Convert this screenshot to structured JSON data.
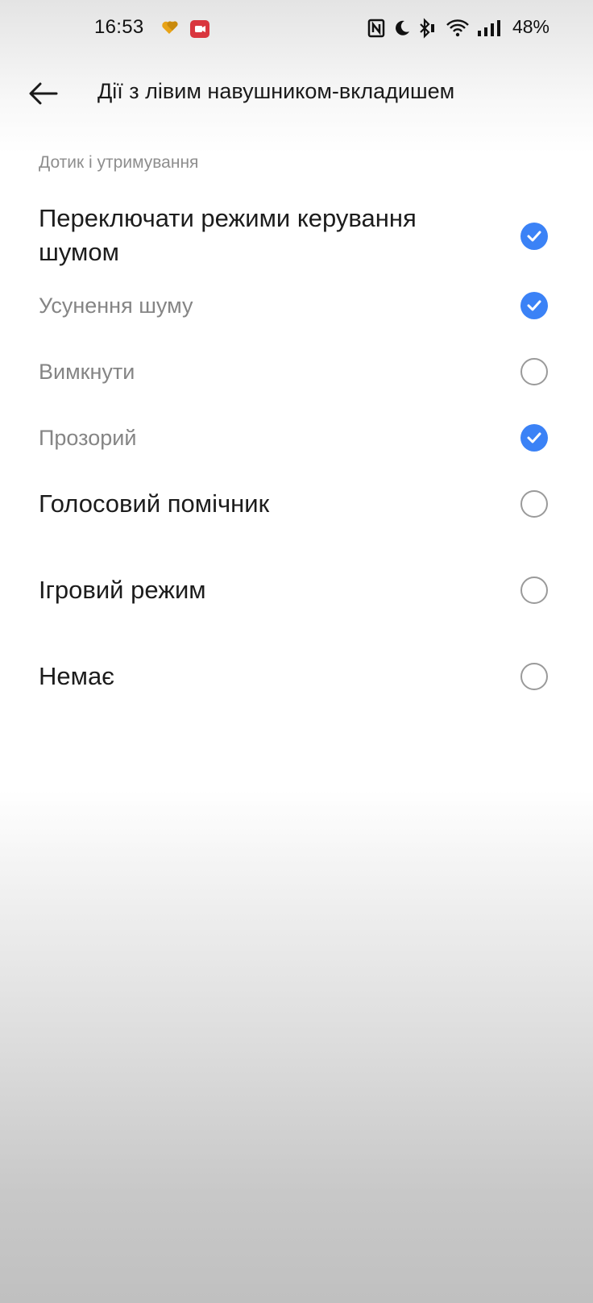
{
  "status_bar": {
    "time": "16:53",
    "battery": "48%",
    "icons": [
      "hearts-app-icon",
      "video-record-icon",
      "nfc-icon",
      "do-not-disturb-moon-icon",
      "bluetooth-icon",
      "wifi-icon",
      "signal-icon"
    ]
  },
  "header": {
    "title": "Дії з лівим навушником-вкладишем",
    "back_icon": "arrow-left-icon"
  },
  "section": {
    "title": "Дотик і утримування"
  },
  "options": [
    {
      "label": "Переключати режими керування шумом",
      "checked": true,
      "style": "primary"
    },
    {
      "label": "Усунення шуму",
      "checked": true,
      "style": "secondary"
    },
    {
      "label": "Вимкнути",
      "checked": false,
      "style": "secondary"
    },
    {
      "label": "Прозорий",
      "checked": true,
      "style": "secondary"
    },
    {
      "label": "Голосовий помічник",
      "checked": false,
      "style": "primary"
    },
    {
      "label": "Ігровий режим",
      "checked": false,
      "style": "primary"
    },
    {
      "label": "Немає",
      "checked": false,
      "style": "primary"
    }
  ],
  "colors": {
    "accent": "#3b82f6",
    "unchecked_border": "#9a9a9a",
    "primary_text": "#1c1c1c",
    "secondary_text": "#858585"
  }
}
